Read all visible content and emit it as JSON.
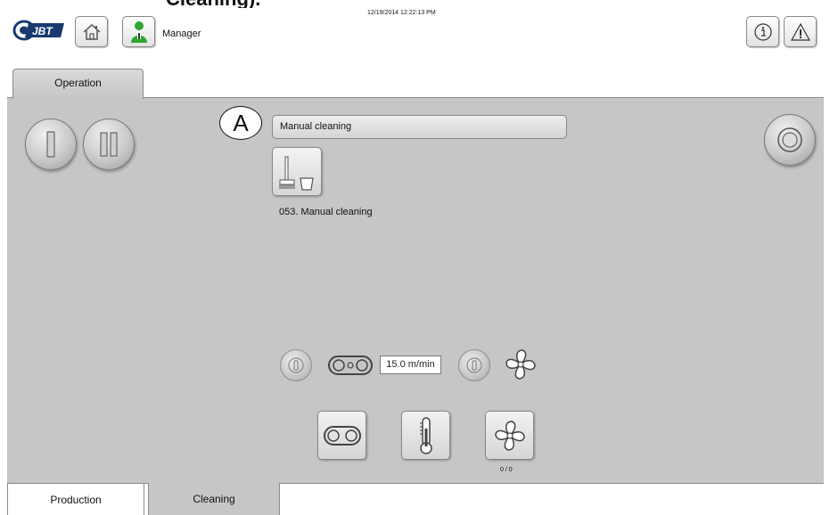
{
  "caption": {
    "text": "Cleaning)."
  },
  "header": {
    "logo_text": "JBT",
    "logo_icon": "jbt-logo",
    "home_icon": "home-icon",
    "user_icon": "user-icon",
    "user_label": "Manager",
    "datetime": "12/19/2014 12:22:13 PM",
    "info_icon": "info-icon",
    "warning_icon": "warning-icon"
  },
  "tabs": {
    "operation": "Operation"
  },
  "main": {
    "marker": "A",
    "program_name": "Manual cleaning",
    "program_icon": "broom-bucket-icon",
    "step_label": "053. Manual cleaning",
    "belt_speed": "15.0 m/min",
    "fan_count": "0 / 0"
  },
  "bottom_tabs": {
    "production": "Production",
    "cleaning": "Cleaning"
  },
  "colors": {
    "background": "#c6c6c6",
    "user_green": "#2fa52f"
  }
}
